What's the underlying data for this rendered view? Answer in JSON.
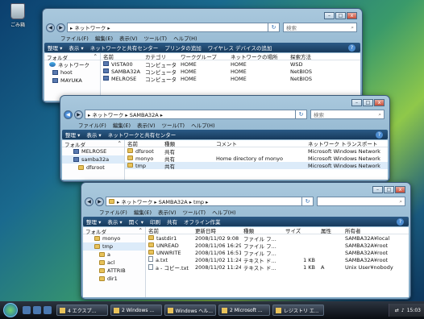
{
  "desktop": {
    "recycle_bin_label": "ごみ箱"
  },
  "win1": {
    "address": "▸ ネットワーク ▸",
    "search_placeholder": "検索",
    "menu": [
      "ファイル(F)",
      "編集(E)",
      "表示(V)",
      "ツール(T)",
      "ヘルプ(H)"
    ],
    "toolbar": [
      "整理 ▾",
      "表示 ▾",
      "ネットワークと共有センター",
      "プリンタの追加",
      "ワイヤレス デバイスの追加"
    ],
    "nav_header": "フォルダ",
    "nav_items": [
      "ネットワーク",
      "hoot",
      "MAYUKA"
    ],
    "columns": [
      "名前",
      "カテゴリ",
      "ワークグループ",
      "ネットワークの場所",
      "探索方法"
    ],
    "rows": [
      [
        "VISTA00",
        "コンピュータ",
        "HOME",
        "HOME",
        "WSD"
      ],
      [
        "SAMBA32A",
        "コンピュータ",
        "HOME",
        "HOME",
        "NetBIOS"
      ],
      [
        "MELROSE",
        "コンピュータ",
        "HOME",
        "HOME",
        "NetBIOS"
      ]
    ]
  },
  "win2": {
    "address": "▸ ネットワーク ▸ SAMBA32A ▸",
    "search_placeholder": "検索",
    "menu": [
      "ファイル(F)",
      "編集(E)",
      "表示(V)",
      "ツール(T)",
      "ヘルプ(H)"
    ],
    "toolbar": [
      "整理 ▾",
      "表示 ▾",
      "ネットワークと共有センター"
    ],
    "nav_header": "フォルダ",
    "nav_items": [
      "MELROSE",
      "samba32a",
      "dfsroot"
    ],
    "columns": [
      "名前",
      "種類",
      "コメント",
      "ネットワーク トランスポート"
    ],
    "rows": [
      [
        "dfsroot",
        "共有",
        "",
        "Microsoft Windows Network"
      ],
      [
        "monyo",
        "共有",
        "Home directory of monyo",
        "Microsoft Windows Network"
      ],
      [
        "tmp",
        "共有",
        "",
        "Microsoft Windows Network"
      ]
    ]
  },
  "win3": {
    "address": "▸ ネットワーク ▸ SAMBA32A ▸ tmp ▸",
    "search_placeholder": "",
    "menu": [
      "ファイル(F)",
      "編集(E)",
      "表示(V)",
      "ツール(T)",
      "ヘルプ(H)"
    ],
    "toolbar": [
      "整理 ▾",
      "表示 ▾",
      "開く ▾",
      "印刷",
      "共有",
      "オフライン作業"
    ],
    "nav_header": "フォルダ",
    "nav_items": [
      "monyo",
      "tmp",
      "a",
      "acl",
      "ATTRIB",
      "dir1"
    ],
    "columns": [
      "名前",
      "更新日時",
      "種類",
      "サイズ",
      "属性",
      "所有者"
    ],
    "rows": [
      [
        "tastdir1",
        "2008/11/02 9:08",
        "ファイル フ...",
        "",
        "",
        "SAMBA32A¥local"
      ],
      [
        "UNREAD",
        "2008/11/06 16:29",
        "ファイル フ...",
        "",
        "",
        "SAMBA32A¥root"
      ],
      [
        "UNWRITE",
        "2008/11/06 16:51",
        "ファイル フ...",
        "",
        "",
        "SAMBA32A¥root"
      ],
      [
        "a.txt",
        "2008/11/02 11:24",
        "テキスト ド...",
        "1 KB",
        "",
        "SAMBA32A¥root"
      ],
      [
        "a - コピー.txt",
        "2008/11/02 11:24",
        "テキスト ド...",
        "1 KB",
        "A",
        "Unix User¥nobody"
      ]
    ]
  },
  "taskbar": {
    "buttons": [
      "4 エクスプ...",
      "2 Windows ...",
      "Windows ヘル...",
      "2 Microsoft ...",
      "レジストリ エ..."
    ],
    "clock": "15:03"
  }
}
